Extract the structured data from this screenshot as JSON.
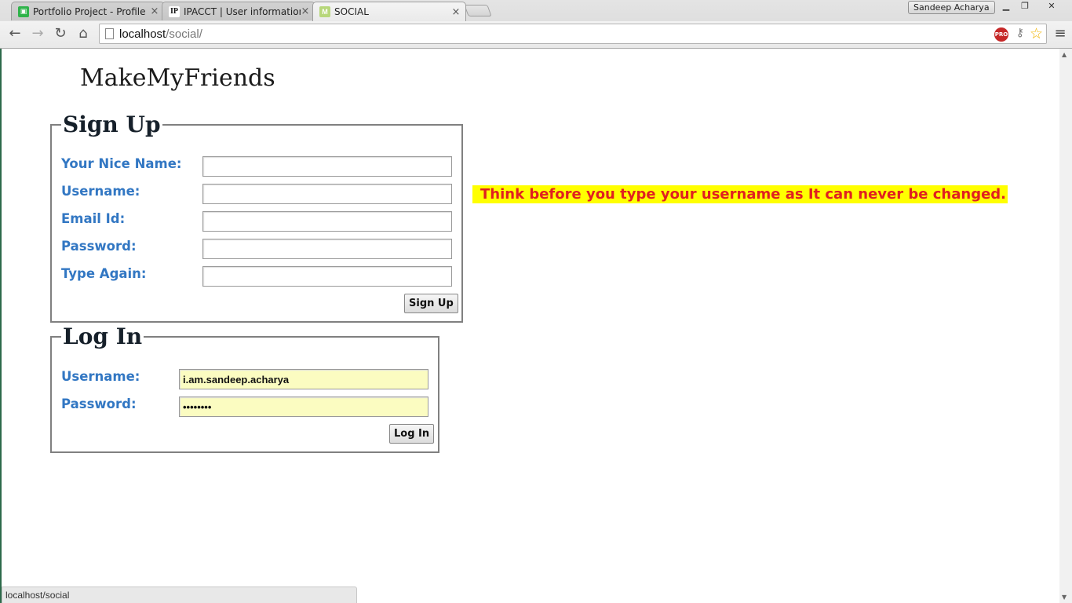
{
  "browser": {
    "tabs": [
      {
        "title": "Portfolio Project - Profile",
        "icon": "green-profile-icon"
      },
      {
        "title": "IPACCT | User information",
        "icon": "ipacct-icon"
      },
      {
        "title": "SOCIAL",
        "icon": "m-logo-icon"
      }
    ],
    "active_tab": 2,
    "profile_name": "Sandeep Acharya",
    "url_host": "localhost",
    "url_path": "/social/",
    "status_text": "localhost/social"
  },
  "page": {
    "site_title": "MakeMyFriends",
    "signup": {
      "legend": "Sign Up",
      "fields": [
        {
          "label": "Your Nice Name:",
          "value": ""
        },
        {
          "label": "Username:",
          "value": ""
        },
        {
          "label": "Email Id:",
          "value": ""
        },
        {
          "label": "Password:",
          "value": ""
        },
        {
          "label": "Type Again:",
          "value": ""
        }
      ],
      "button": "Sign Up"
    },
    "login": {
      "legend": "Log In",
      "fields": [
        {
          "label": "Username:",
          "value": "i.am.sandeep.acharya"
        },
        {
          "label": "Password:",
          "value": "••••••••"
        }
      ],
      "button": "Log In"
    },
    "warning": "Think before you type your username as It can never be changed.",
    "colors": {
      "label": "#3277c3",
      "warning_text": "#e02020",
      "warning_bg": "#ffff00",
      "autofill_bg": "#fbfcc1"
    }
  }
}
